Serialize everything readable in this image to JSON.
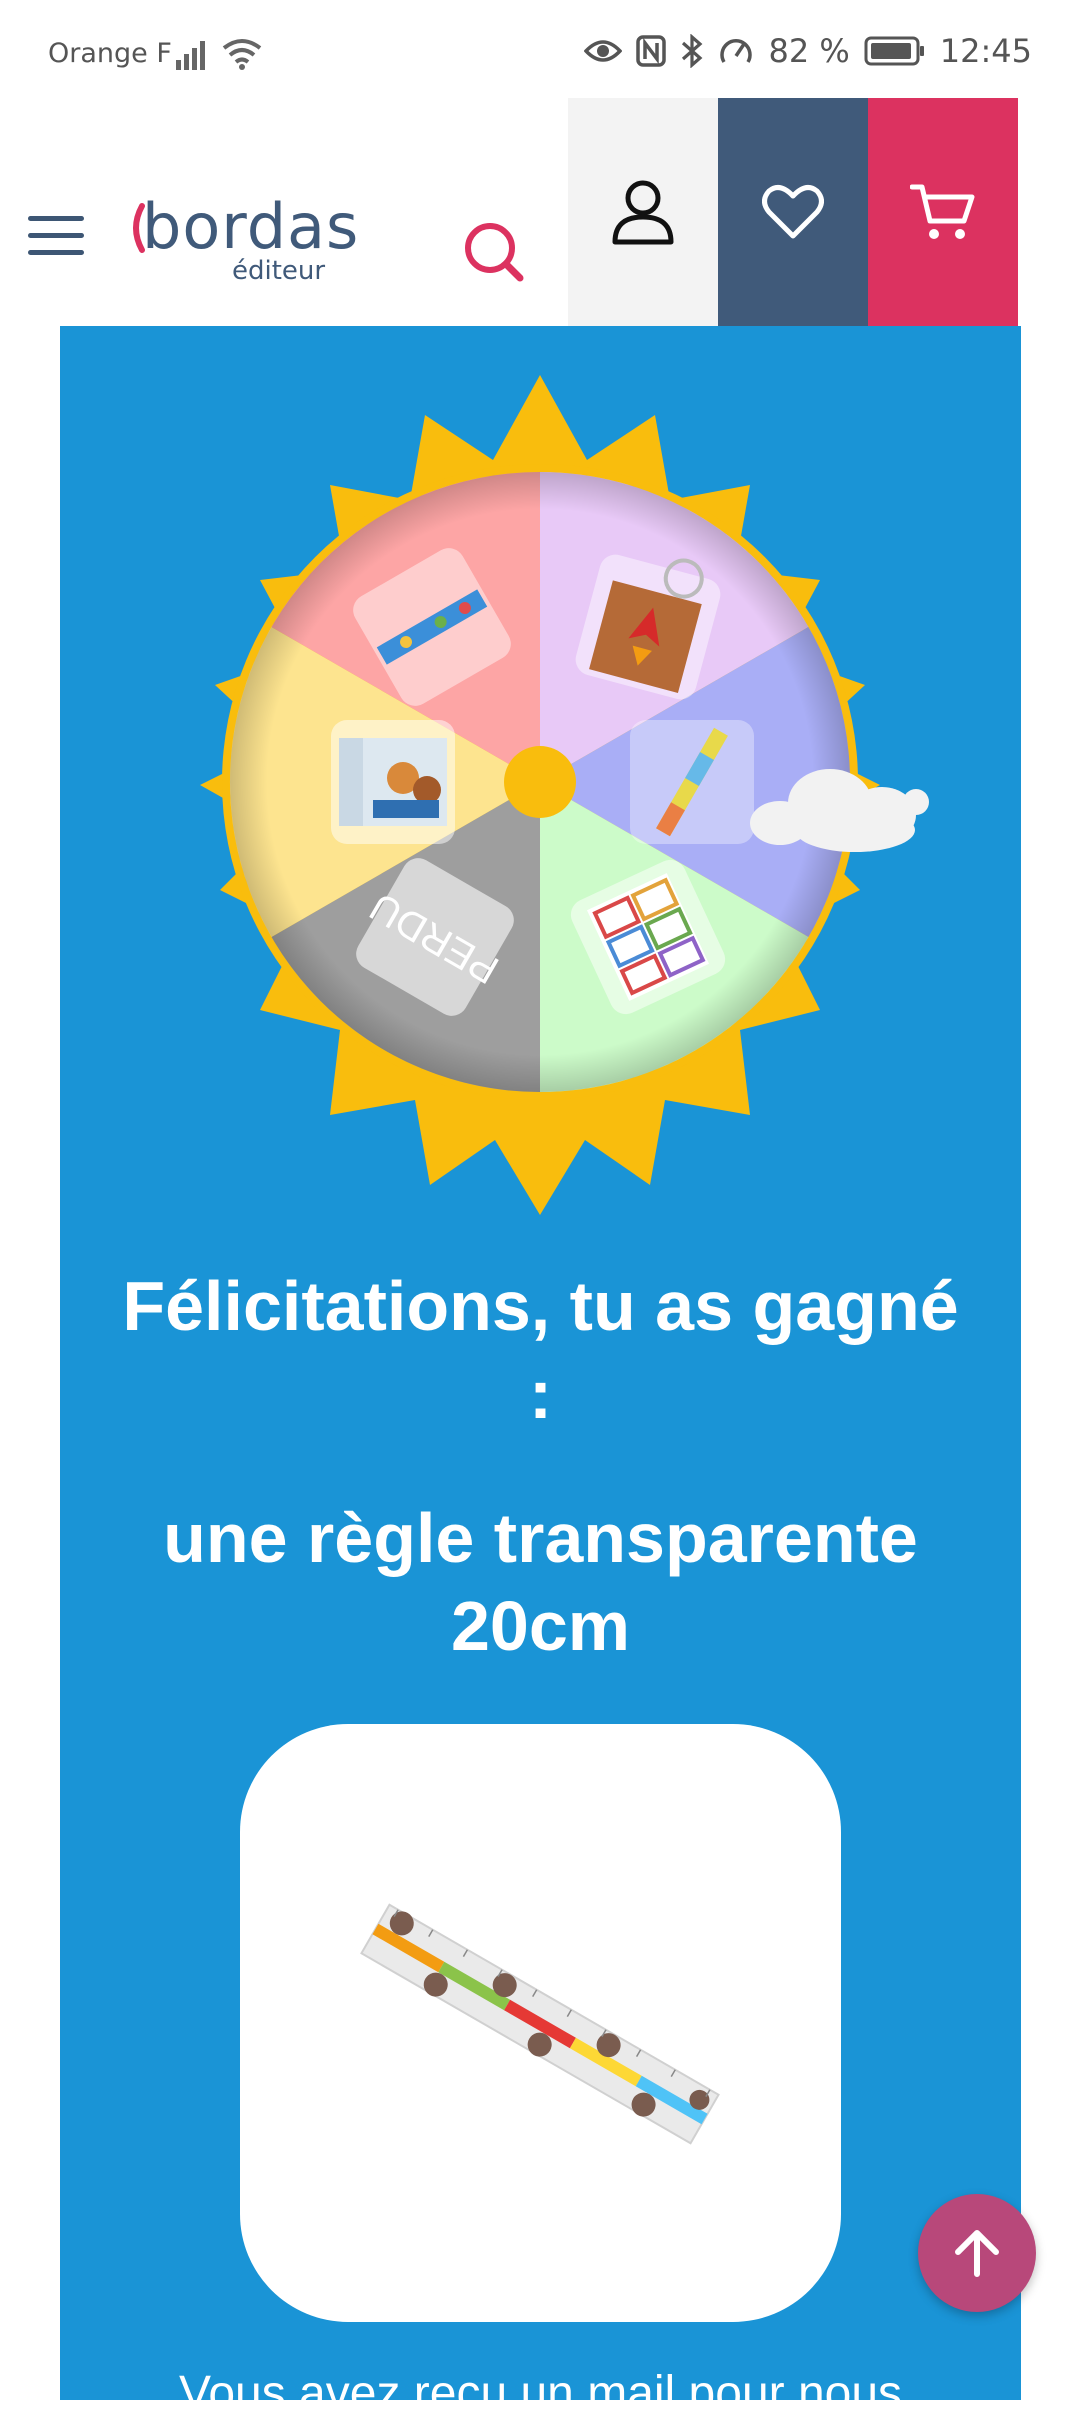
{
  "status_bar": {
    "carrier": "Orange F",
    "battery": "82 %",
    "time": "12:45",
    "icons": [
      "signal-icon",
      "wifi-icon",
      "eye-icon",
      "nfc-icon",
      "bluetooth-icon",
      "speed-icon",
      "battery-icon"
    ]
  },
  "header": {
    "logo_main": "bordas",
    "logo_sub": "éditeur",
    "icons": [
      "menu-icon",
      "search-icon",
      "account-icon",
      "heart-icon",
      "cart-icon"
    ]
  },
  "colors": {
    "brand_red": "#dc3260",
    "brand_navy": "#405a7a",
    "panel_blue": "#1a94d6",
    "sun_yellow": "#f9bd0d"
  },
  "wheel": {
    "segments": [
      {
        "prize": "ruler-prize",
        "color": "#fda5a5"
      },
      {
        "prize": "rocket-keyring-prize",
        "color": "#e8c9f7"
      },
      {
        "prize": "colored-ruler-prize",
        "color": "#a9aef6"
      },
      {
        "prize": "stickers-prize",
        "color": "#ccfbc9"
      },
      {
        "prize": "lost",
        "color": "#9e9e9e",
        "label": "PERDU"
      },
      {
        "prize": "book-prize",
        "color": "#fde48f"
      }
    ]
  },
  "result": {
    "congrats_line1": "Félicitations, tu as gagné",
    "congrats_line2": ":",
    "prize_line1": "une règle transparente",
    "prize_line2": "20cm"
  },
  "footer_text": "Vous avez reçu un mail pour nous"
}
